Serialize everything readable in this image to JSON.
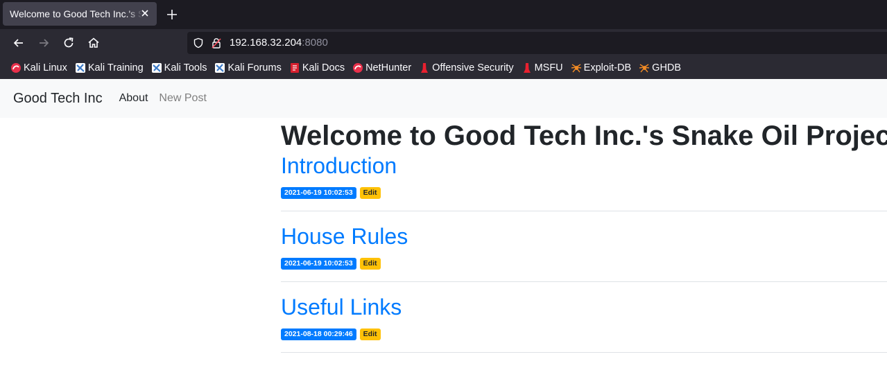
{
  "browser": {
    "tab": {
      "title": "Welcome to Good Tech Inc.'s Snake Oil Project"
    },
    "url": {
      "host": "192.168.32.204",
      "port": ":8080"
    },
    "bookmarks": [
      {
        "label": "Kali Linux",
        "icon": "kali-dragon-icon"
      },
      {
        "label": "Kali Training",
        "icon": "kali-training-icon"
      },
      {
        "label": "Kali Tools",
        "icon": "kali-tools-icon"
      },
      {
        "label": "Kali Forums",
        "icon": "kali-forums-icon"
      },
      {
        "label": "Kali Docs",
        "icon": "kali-docs-icon"
      },
      {
        "label": "NetHunter",
        "icon": "nethunter-icon"
      },
      {
        "label": "Offensive Security",
        "icon": "offsec-icon"
      },
      {
        "label": "MSFU",
        "icon": "msfu-icon"
      },
      {
        "label": "Exploit-DB",
        "icon": "exploit-db-icon"
      },
      {
        "label": "GHDB",
        "icon": "ghdb-icon"
      }
    ]
  },
  "site": {
    "brand": "Good Tech Inc",
    "nav": {
      "about": "About",
      "new_post": "New Post"
    },
    "heading": "Welcome to Good Tech Inc.'s Snake Oil Project",
    "posts": [
      {
        "title": "Introduction",
        "date": "2021-06-19 10:02:53",
        "edit": "Edit"
      },
      {
        "title": "House Rules",
        "date": "2021-06-19 10:02:53",
        "edit": "Edit"
      },
      {
        "title": "Useful Links",
        "date": "2021-08-18 00:29:46",
        "edit": "Edit"
      }
    ]
  },
  "colors": {
    "primary": "#007bff",
    "warning": "#ffc107",
    "navbar_bg": "#f8f9fa"
  }
}
